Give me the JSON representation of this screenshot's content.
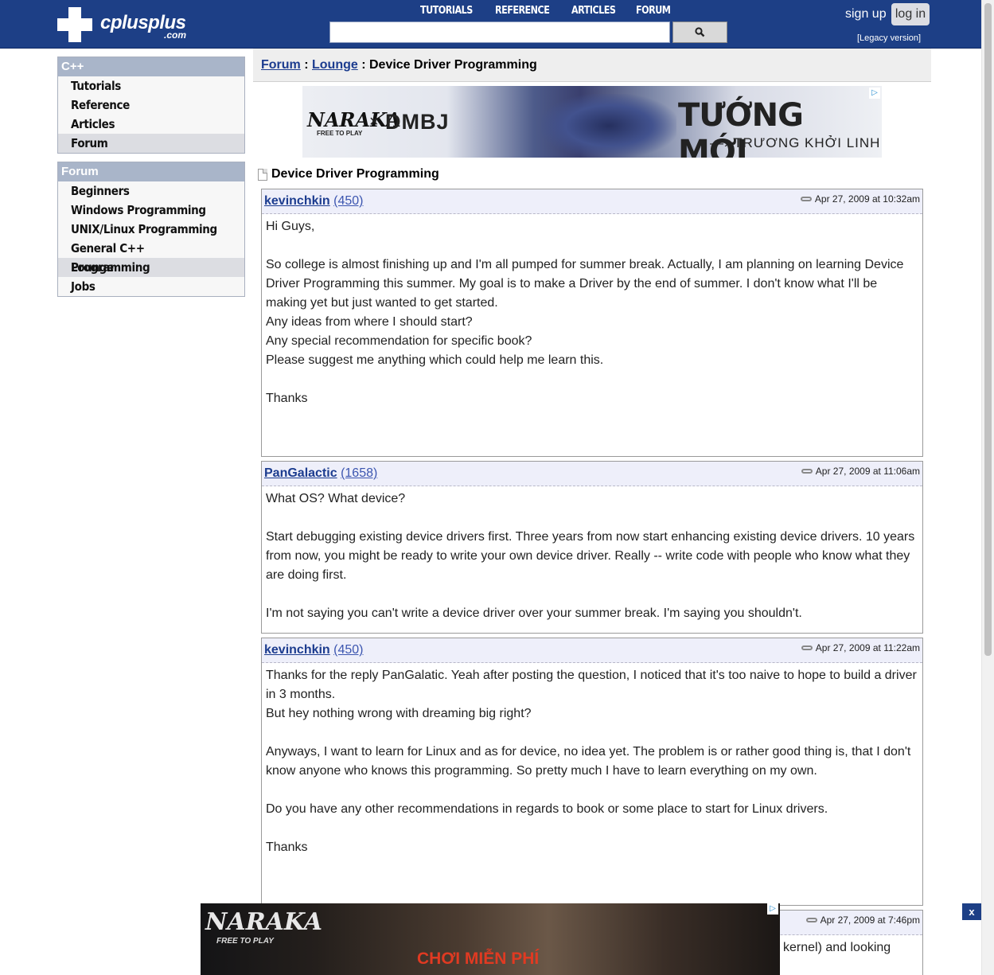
{
  "header": {
    "logo_text": "cplusplus",
    "logo_suffix": ".com",
    "nav": [
      "TUTORIALS",
      "REFERENCE",
      "ARTICLES",
      "FORUM"
    ],
    "search_value": "",
    "sign_up": "sign up",
    "log_in": "log in",
    "legacy": "[Legacy version]"
  },
  "sidebar": {
    "cpp": {
      "title": "C++",
      "items": [
        "Tutorials",
        "Reference",
        "Articles",
        "Forum"
      ],
      "active_index": 3
    },
    "forum": {
      "title": "Forum",
      "items": [
        "Beginners",
        "Windows Programming",
        "UNIX/Linux Programming",
        "General C++ Programming",
        "Lounge",
        "Jobs"
      ],
      "active_index": 4
    }
  },
  "breadcrumb": {
    "forum": "Forum",
    "sep1": " : ",
    "lounge": "Lounge",
    "sep2": " : ",
    "current": "Device Driver Programming"
  },
  "ad_top": {
    "brand": "NARAKA",
    "brand_sub": "FREE TO PLAY",
    "x": "×",
    "partner": "DMBJ",
    "headline": "TƯỚNG MỚI",
    "subline": "—› TRƯƠNG KHỞI LINH ‹—"
  },
  "thread": {
    "title": "Device Driver Programming"
  },
  "posts": [
    {
      "user": "kevinchkin",
      "count": "(450)",
      "date": "Apr 27, 2009 at 10:32am",
      "body": "Hi Guys,\n\nSo college is almost finishing up and I'm all pumped for summer break. Actually, I am planning on learning Device Driver Programming this summer. My goal is to make a Driver by the end of summer. I don't know what I'll be making yet but just wanted to get started.\nAny ideas from where I should start?\nAny special recommendation for specific book?\nPlease suggest me anything which could help me learn this.\n\nThanks"
    },
    {
      "user": "PanGalactic",
      "count": "(1658)",
      "date": "Apr 27, 2009 at 11:06am",
      "body": "What OS? What device?\n\nStart debugging existing device drivers first. Three years from now start enhancing existing device drivers. 10 years from now, you might be ready to write your own device driver. Really -- write code with people who know what they are doing first.\n\nI'm not saying you can't write a device driver over your summer break. I'm saying you shouldn't."
    },
    {
      "user": "kevinchkin",
      "count": "(450)",
      "date": "Apr 27, 2009 at 11:22am",
      "body": "Thanks for the reply PanGalatic. Yeah after posting the question, I noticed that it's too naive to hope to build a driver in 3 months.\nBut hey nothing wrong with dreaming big right?\n\nAnyways, I want to learn for Linux and as for device, no idea yet. The problem is or rather good thing is, that I don't know anyone who knows this programming. So pretty much I have to learn everything on my own.\n\nDo you have any other recommendations in regards to book or some place to start for Linux drivers.\n\nThanks"
    },
    {
      "date": "Apr 27, 2009 at 7:46pm",
      "body_fragment": "kernel) and looking"
    }
  ],
  "ad_bottom": {
    "brand": "NARAKA",
    "brand_sub": "FREE TO PLAY",
    "cta": "CHƠI MIỄN PHÍ",
    "close": "x"
  },
  "colors": {
    "header_bg": "#1d3f86",
    "link": "#1c3c8f",
    "sidebar_head": "#a9b5c9",
    "post_head_bg": "#eeeffa"
  }
}
